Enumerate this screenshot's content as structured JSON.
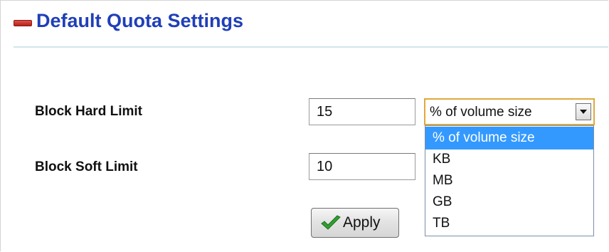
{
  "header": {
    "title": "Default Quota Settings",
    "collapse_icon": "minus-icon"
  },
  "form": {
    "hard_limit": {
      "label": "Block Hard Limit",
      "value": "15"
    },
    "soft_limit": {
      "label": "Block Soft Limit",
      "value": "10"
    },
    "unit_select": {
      "selected": "% of volume size",
      "options": [
        "% of volume size",
        "KB",
        "MB",
        "GB",
        "TB"
      ],
      "highlighted_index": 0
    },
    "apply_button": {
      "label": "Apply",
      "icon": "checkmark-icon"
    }
  },
  "colors": {
    "title": "#1f3fb8",
    "accent_rule": "#cfe6ea",
    "select_focus_border": "#e0a93a",
    "option_highlight": "#3399ff",
    "check_green": "#2fa12f"
  }
}
